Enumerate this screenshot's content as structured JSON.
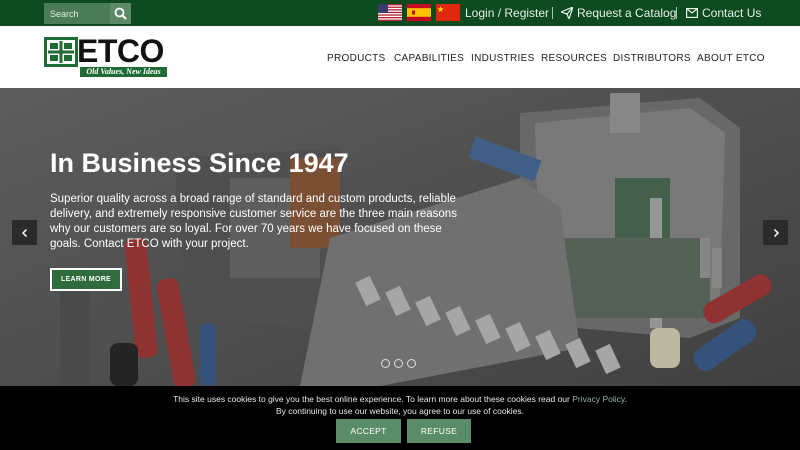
{
  "topbar": {
    "search_placeholder": "Search",
    "search_icon": "search-icon",
    "flags": [
      "us-flag-icon",
      "spain-flag-icon",
      "china-flag-icon"
    ],
    "login_label": "Login / Register",
    "catalog_label": "Request a Catalog",
    "contact_label": "Contact Us",
    "catalog_icon": "paper-plane-icon",
    "contact_icon": "envelope-icon"
  },
  "logo": {
    "name": "ETCO",
    "tagline": "Old Values, New Ideas"
  },
  "nav": {
    "items": [
      "PRODUCTS",
      "CAPABILITIES",
      "INDUSTRIES",
      "RESOURCES",
      "DISTRIBUTORS",
      "ABOUT ETCO"
    ]
  },
  "hero": {
    "title": "In Business Since 1947",
    "text": "Superior quality across a broad range of standard and custom products, reliable delivery, and extremely responsive customer service are the three main reasons why our customers are so loyal. For over 70 years we have focused on these goals. Contact ETCO with your project.",
    "button_label": "LEARN MORE",
    "prev_icon": "chevron-left-icon",
    "next_icon": "chevron-right-icon",
    "slide_count": 3
  },
  "cookie": {
    "line1_text": "This site uses cookies to give you the best online experience. To learn more about these cookies read our ",
    "policy_link": "Privacy Policy",
    "line1_end": ".",
    "line2": "By continuing to use our website, you agree to our use of cookies.",
    "accept_label": "ACCEPT",
    "refuse_label": "REFUSE"
  },
  "colors": {
    "topbar_bg": "#0d4a1f",
    "brand_green": "#1f6b34",
    "button_green": "#5b8c6a",
    "cookie_bg": "#000000"
  }
}
